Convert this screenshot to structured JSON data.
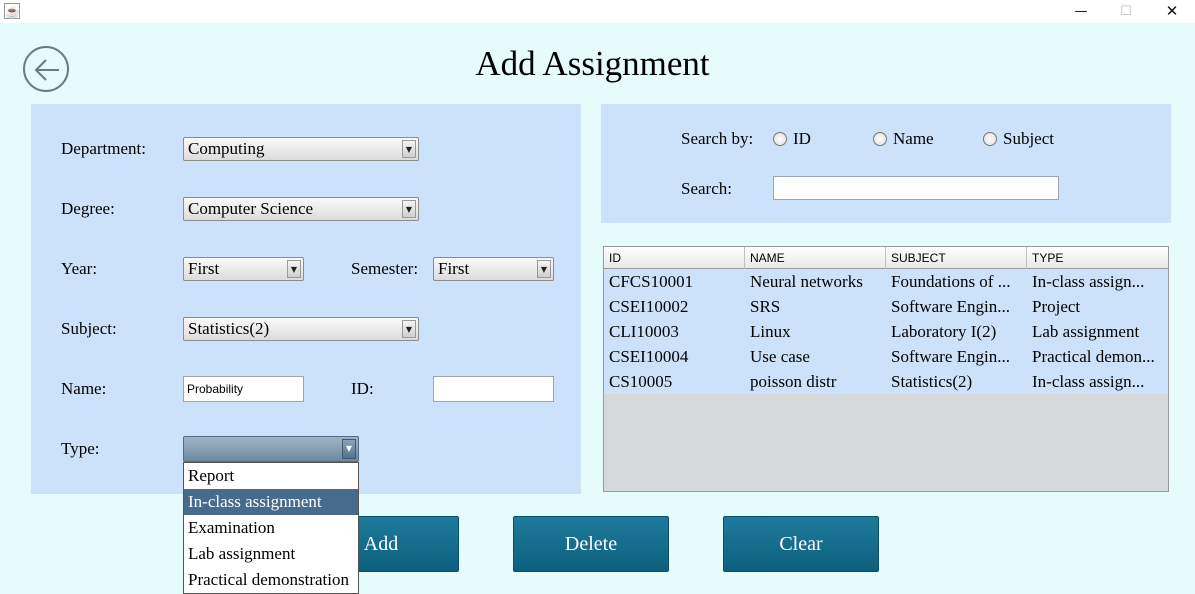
{
  "window": {
    "minimize_glyph": "—",
    "maximize_glyph": "☐",
    "close_glyph": "✕"
  },
  "header": {
    "title": "Add Assignment",
    "back_icon": "arrow-left-circle-icon"
  },
  "form": {
    "department": {
      "label": "Department:",
      "value": "Computing"
    },
    "degree": {
      "label": "Degree:",
      "value": "Computer Science"
    },
    "year": {
      "label": "Year:",
      "value": "First"
    },
    "semester": {
      "label": "Semester:",
      "value": "First"
    },
    "subject": {
      "label": "Subject:",
      "value": "Statistics(2)"
    },
    "name": {
      "label": "Name:",
      "value": "Probability"
    },
    "id": {
      "label": "ID:",
      "value": ""
    },
    "type": {
      "label": "Type:",
      "value": "",
      "options": [
        "Report",
        "In-class assignment",
        "Examination",
        "Lab assignment",
        "Practical demonstration"
      ],
      "highlighted": "In-class assignment"
    }
  },
  "search": {
    "by_label": "Search by:",
    "options": [
      "ID",
      "Name",
      "Subject"
    ],
    "search_label": "Search:",
    "search_value": ""
  },
  "table": {
    "columns": [
      "ID",
      "NAME",
      "SUBJECT",
      "TYPE"
    ],
    "rows": [
      [
        "CFCS10001",
        "Neural networks",
        "Foundations of ...",
        "In-class assign..."
      ],
      [
        "CSEI10002",
        "SRS",
        "Software Engin...",
        "Project"
      ],
      [
        "CLI10003",
        "Linux",
        "Laboratory I(2)",
        "Lab assignment"
      ],
      [
        "CSEI10004",
        "Use case",
        "Software Engin...",
        "Practical demon..."
      ],
      [
        "CS10005",
        "poisson distr",
        "Statistics(2)",
        "In-class assign..."
      ]
    ]
  },
  "buttons": {
    "add": "Add",
    "delete": "Delete",
    "clear": "Clear"
  },
  "colors": {
    "background": "#e6fbfb",
    "panel": "#cce2fb",
    "button": "#146d8e",
    "selection": "#476b8c"
  }
}
